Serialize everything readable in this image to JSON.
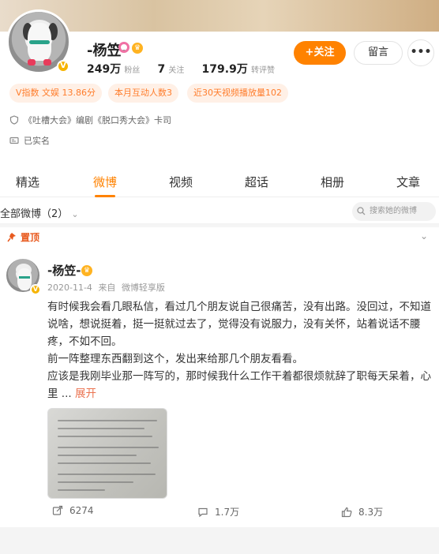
{
  "profile": {
    "name": "-杨笠-",
    "fans_count": "249万",
    "fans_label": "粉丝",
    "follow_count": "7",
    "follow_label": "关注",
    "likes_count": "179.9万",
    "likes_label": "转评赞",
    "follow_button": "+关注",
    "message_button": "留言",
    "more_button": "•••"
  },
  "tags": [
    "V指数 文娱 13.86分",
    "本月互动人数3",
    "近30天视频播放量102"
  ],
  "info": {
    "line1": "《吐槽大会》编剧《脱口秀大会》卡司",
    "line2": "已实名"
  },
  "tabs": [
    "精选",
    "微博",
    "视频",
    "超话",
    "相册",
    "文章"
  ],
  "active_tab": "微博",
  "filter": {
    "label": "全部微博（2）",
    "search_placeholder": "搜索她的微博"
  },
  "post": {
    "pinned_label": "置顶",
    "author": "-杨笠-",
    "date": "2020-11-4",
    "source_prefix": "来自",
    "source": "微博轻享版",
    "paragraph1": "有时候我会看几眼私信，看过几个朋友说自己很痛苦，没有出路。没回过，不知道说啥，想说挺着，挺一挺就过去了，觉得没有说服力，没有关怀，站着说话不腰疼，不如不回。",
    "paragraph2": "前一阵整理东西翻到这个，发出来给那几个朋友看看。",
    "paragraph3": "应该是我刚毕业那一阵写的，那时候我什么工作干着都很烦就辞了职每天呆着，心里 ...",
    "expand_label": "展开",
    "repost_count": "6274",
    "comment_count": "1.7万",
    "like_count": "8.3万"
  },
  "colors": {
    "accent": "#ff8200",
    "tag_bg": "#fff0e6",
    "tag_text": "#ff7d2c",
    "pinned": "#e85a1f"
  }
}
